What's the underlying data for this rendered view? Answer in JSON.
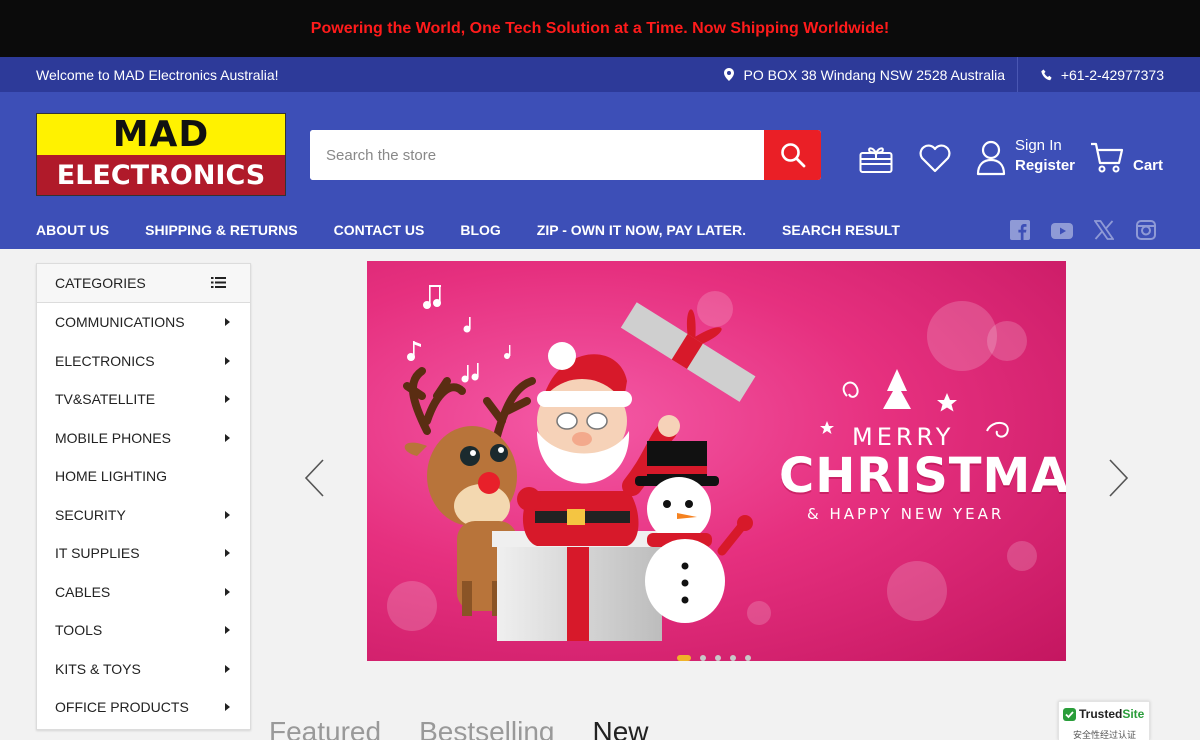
{
  "promo": {
    "text": "Powering the World, One Tech Solution at a Time. Now Shipping Worldwide!"
  },
  "utility_bar": {
    "welcome": "Welcome to MAD Electronics Australia!",
    "address": "PO BOX 38 Windang NSW 2528 Australia",
    "phone": "+61-2-42977373"
  },
  "header": {
    "logo_top": "MAD",
    "logo_bottom": "ELECTRONICS",
    "search_placeholder": "Search the store",
    "sign_in": "Sign In",
    "register": "Register",
    "cart": "Cart"
  },
  "nav": {
    "items": [
      "ABOUT US",
      "SHIPPING & RETURNS",
      "CONTACT US",
      "BLOG",
      "ZIP - OWN IT NOW, PAY LATER.",
      "SEARCH RESULT"
    ]
  },
  "social": [
    "facebook-icon",
    "youtube-icon",
    "x-icon",
    "instagram-icon"
  ],
  "categories": {
    "title": "CATEGORIES",
    "items": [
      {
        "label": "COMMUNICATIONS",
        "has_sub": true
      },
      {
        "label": "ELECTRONICS",
        "has_sub": true
      },
      {
        "label": "TV&SATELLITE",
        "has_sub": true
      },
      {
        "label": "MOBILE PHONES",
        "has_sub": true
      },
      {
        "label": "HOME LIGHTING",
        "has_sub": false
      },
      {
        "label": "SECURITY",
        "has_sub": true
      },
      {
        "label": "IT SUPPLIES",
        "has_sub": true
      },
      {
        "label": "CABLES",
        "has_sub": true
      },
      {
        "label": "TOOLS",
        "has_sub": true
      },
      {
        "label": "KITS & TOYS",
        "has_sub": true
      },
      {
        "label": "OFFICE PRODUCTS",
        "has_sub": true
      }
    ]
  },
  "banner": {
    "merry": "MERRY",
    "title": "CHRISTMAS",
    "subtitle": "& HAPPY NEW YEAR",
    "slide_count": 5,
    "active_slide": 1
  },
  "product_tabs": [
    "Featured",
    "Bestselling",
    "New"
  ],
  "trusted": {
    "name_a": "Trusted",
    "name_b": "Site",
    "sub": "安全性经过认证"
  },
  "colors": {
    "promo_text": "#ff1b1b",
    "util_bar": "#2d3a99",
    "header": "#3d4fb7",
    "search_button": "#ea1f26",
    "logo_yellow": "#fff200",
    "logo_red": "#b01a2a"
  }
}
